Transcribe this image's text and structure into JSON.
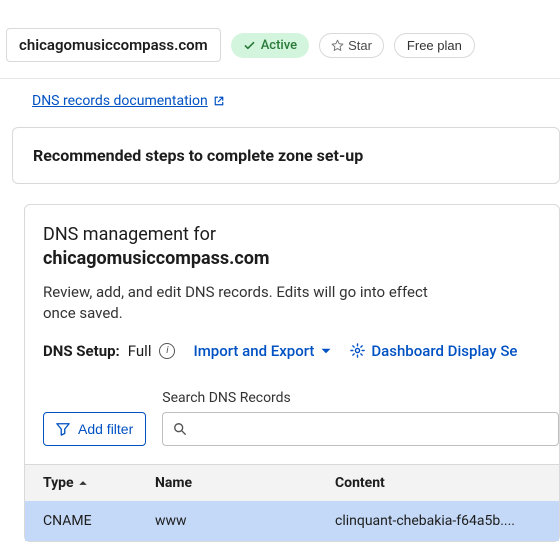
{
  "header": {
    "domain": "chicagomusiccompass.com",
    "status": "Active",
    "star_label": "Star",
    "plan_label": "Free plan"
  },
  "doc_link": "DNS records documentation",
  "recommended_card": {
    "title": "Recommended steps to complete zone set-up"
  },
  "dns_panel": {
    "heading_prefix": "DNS management for",
    "heading_domain": "chicagomusiccompass.com",
    "description": "Review, add, and edit DNS records. Edits will go into effect once saved.",
    "setup_label": "DNS Setup:",
    "setup_value": "Full",
    "import_export": "Import and Export",
    "dashboard_display": "Dashboard Display Se",
    "add_filter": "Add filter",
    "search_label": "Search DNS Records",
    "search_placeholder": ""
  },
  "table": {
    "columns": {
      "type": "Type",
      "name": "Name",
      "content": "Content"
    },
    "rows": [
      {
        "type": "CNAME",
        "name": "www",
        "content": "clinquant-chebakia-f64a5b...."
      }
    ]
  }
}
